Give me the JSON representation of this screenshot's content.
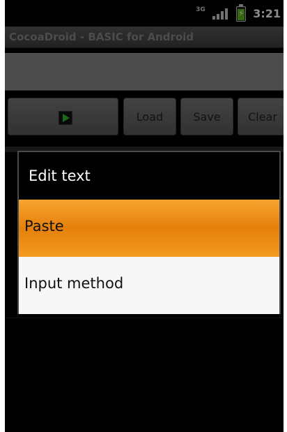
{
  "status_bar": {
    "data_indicator": "3G",
    "time": "3:21",
    "battery_icon": "battery-charging-icon",
    "signal_icon": "signal-bars-icon"
  },
  "app": {
    "title": "CocoaDroid - BASIC for Android"
  },
  "editor": {
    "value": ""
  },
  "toolbar": {
    "run_icon": "play-icon",
    "load_label": "Load",
    "save_label": "Save",
    "clear_label": "Clear"
  },
  "dialog": {
    "title": "Edit text",
    "items": [
      {
        "label": "Paste",
        "state": "highlighted"
      },
      {
        "label": "Input method",
        "state": "normal"
      }
    ]
  },
  "colors": {
    "highlight": "#e6800c",
    "run_green": "#2fc32f",
    "console_green": "#1f8f1f"
  }
}
